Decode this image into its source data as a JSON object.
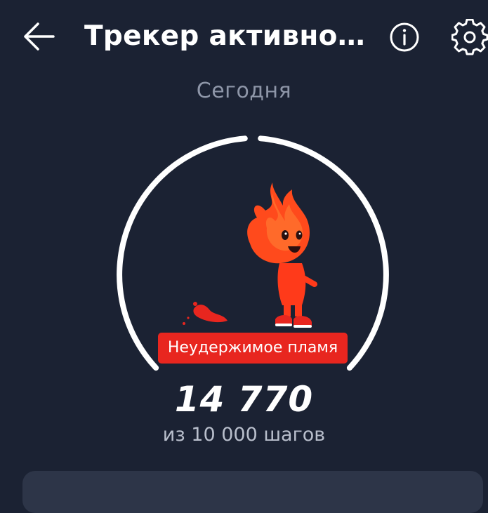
{
  "header": {
    "title": "Трекер активнос...",
    "back_icon": "arrow-left-icon",
    "info_icon": "info-icon",
    "settings_icon": "gear-icon"
  },
  "period": "Сегодня",
  "progress": {
    "level_name": "Неудержимое пламя",
    "steps": "14 770",
    "goal_text": "из 10 000 шагов",
    "fraction": 1.0
  },
  "colors": {
    "background": "#1b2233",
    "badge": "#e8261f",
    "ring": "#ffffff",
    "muted_text": "#8e96a8",
    "card": "#2d3548"
  },
  "mascot_icon": "flame-mascot-icon"
}
